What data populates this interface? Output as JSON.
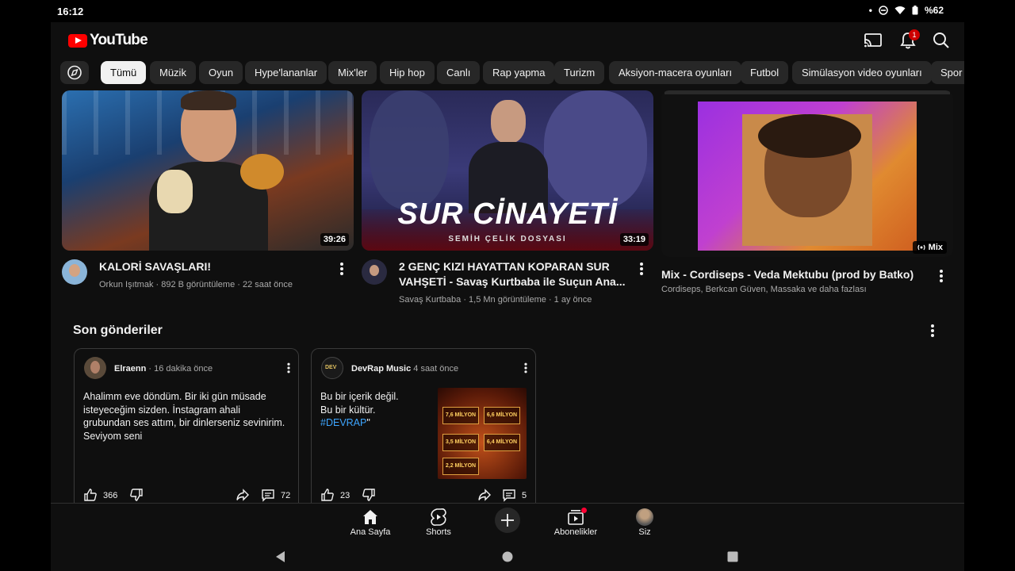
{
  "status": {
    "time": "16:12",
    "battery": "%62"
  },
  "header": {
    "logo_text": "YouTube",
    "notification_count": "1"
  },
  "chips": [
    "Tümü",
    "Müzik",
    "Oyun",
    "Hype'lananlar",
    "Mix'ler",
    "Hip hop",
    "Canlı",
    "Rap yapma",
    "Turizm",
    "Aksiyon-macera oyunları",
    "Futbol",
    "Simülasyon video oyunları",
    "Spor"
  ],
  "videos": [
    {
      "duration": "39:26",
      "title": "KALORİ SAVAŞLARI!",
      "channel": "Orkun Işıtmak",
      "meta": "Orkun Işıtmak · 892 B görüntüleme · 22 saat önce"
    },
    {
      "duration": "33:19",
      "title_line1": "2 GENÇ KIZI HAYATTAN KOPARAN SUR",
      "title_line2": "VAHŞETİ - Savaş Kurtbaba ile Suçun Ana...",
      "overlay_title": "SUR CİNAYETİ",
      "overlay_sub": "SEMİH ÇELİK DOSYASI",
      "meta": "Savaş Kurtbaba · 1,5 Mn görüntüleme · 1 ay önce"
    },
    {
      "badge": "Mix",
      "title": "Mix - Cordiseps - Veda Mektubu (prod by Batko)",
      "meta": "Cordiseps, Berkcan Güven, Massaka ve daha fazlası"
    }
  ],
  "section": {
    "title": "Son gönderiler"
  },
  "posts": [
    {
      "author": "Elraenn",
      "time": "· 16 dakika önce",
      "lines": [
        "Ahalimm eve döndüm. Bir iki gün müsade",
        "isteyeceğim sizden. İnstagram ahali",
        "grubundan ses attım, bir dinlerseniz sevinirim.",
        "Seviyom seni"
      ],
      "likes": "366",
      "comments": "72"
    },
    {
      "author": "DevRap Music",
      "time": "4 saat önce",
      "lines": [
        "Bu bir içerik değil.",
        "Bu bir kültür."
      ],
      "hashtag": "#DEVRAP",
      "hash_suffix": "\"",
      "likes": "23",
      "comments": "5",
      "image_texts": [
        "7,6 MİLYON",
        "6,6 MİLYON",
        "3,5 MİLYON",
        "6,4 MİLYON",
        "2,2 MİLYON"
      ]
    }
  ],
  "nav": [
    {
      "label": "Ana Sayfa",
      "icon": "home-icon"
    },
    {
      "label": "Shorts",
      "icon": "shorts-icon"
    },
    {
      "label": "",
      "icon": "create-icon"
    },
    {
      "label": "Abonelikler",
      "icon": "subscriptions-icon"
    },
    {
      "label": "Siz",
      "icon": "avatar"
    }
  ],
  "colors": {
    "brand": "#ff0000",
    "background": "#0f0f0f",
    "chip": "#272727",
    "link": "#3ea6ff"
  }
}
